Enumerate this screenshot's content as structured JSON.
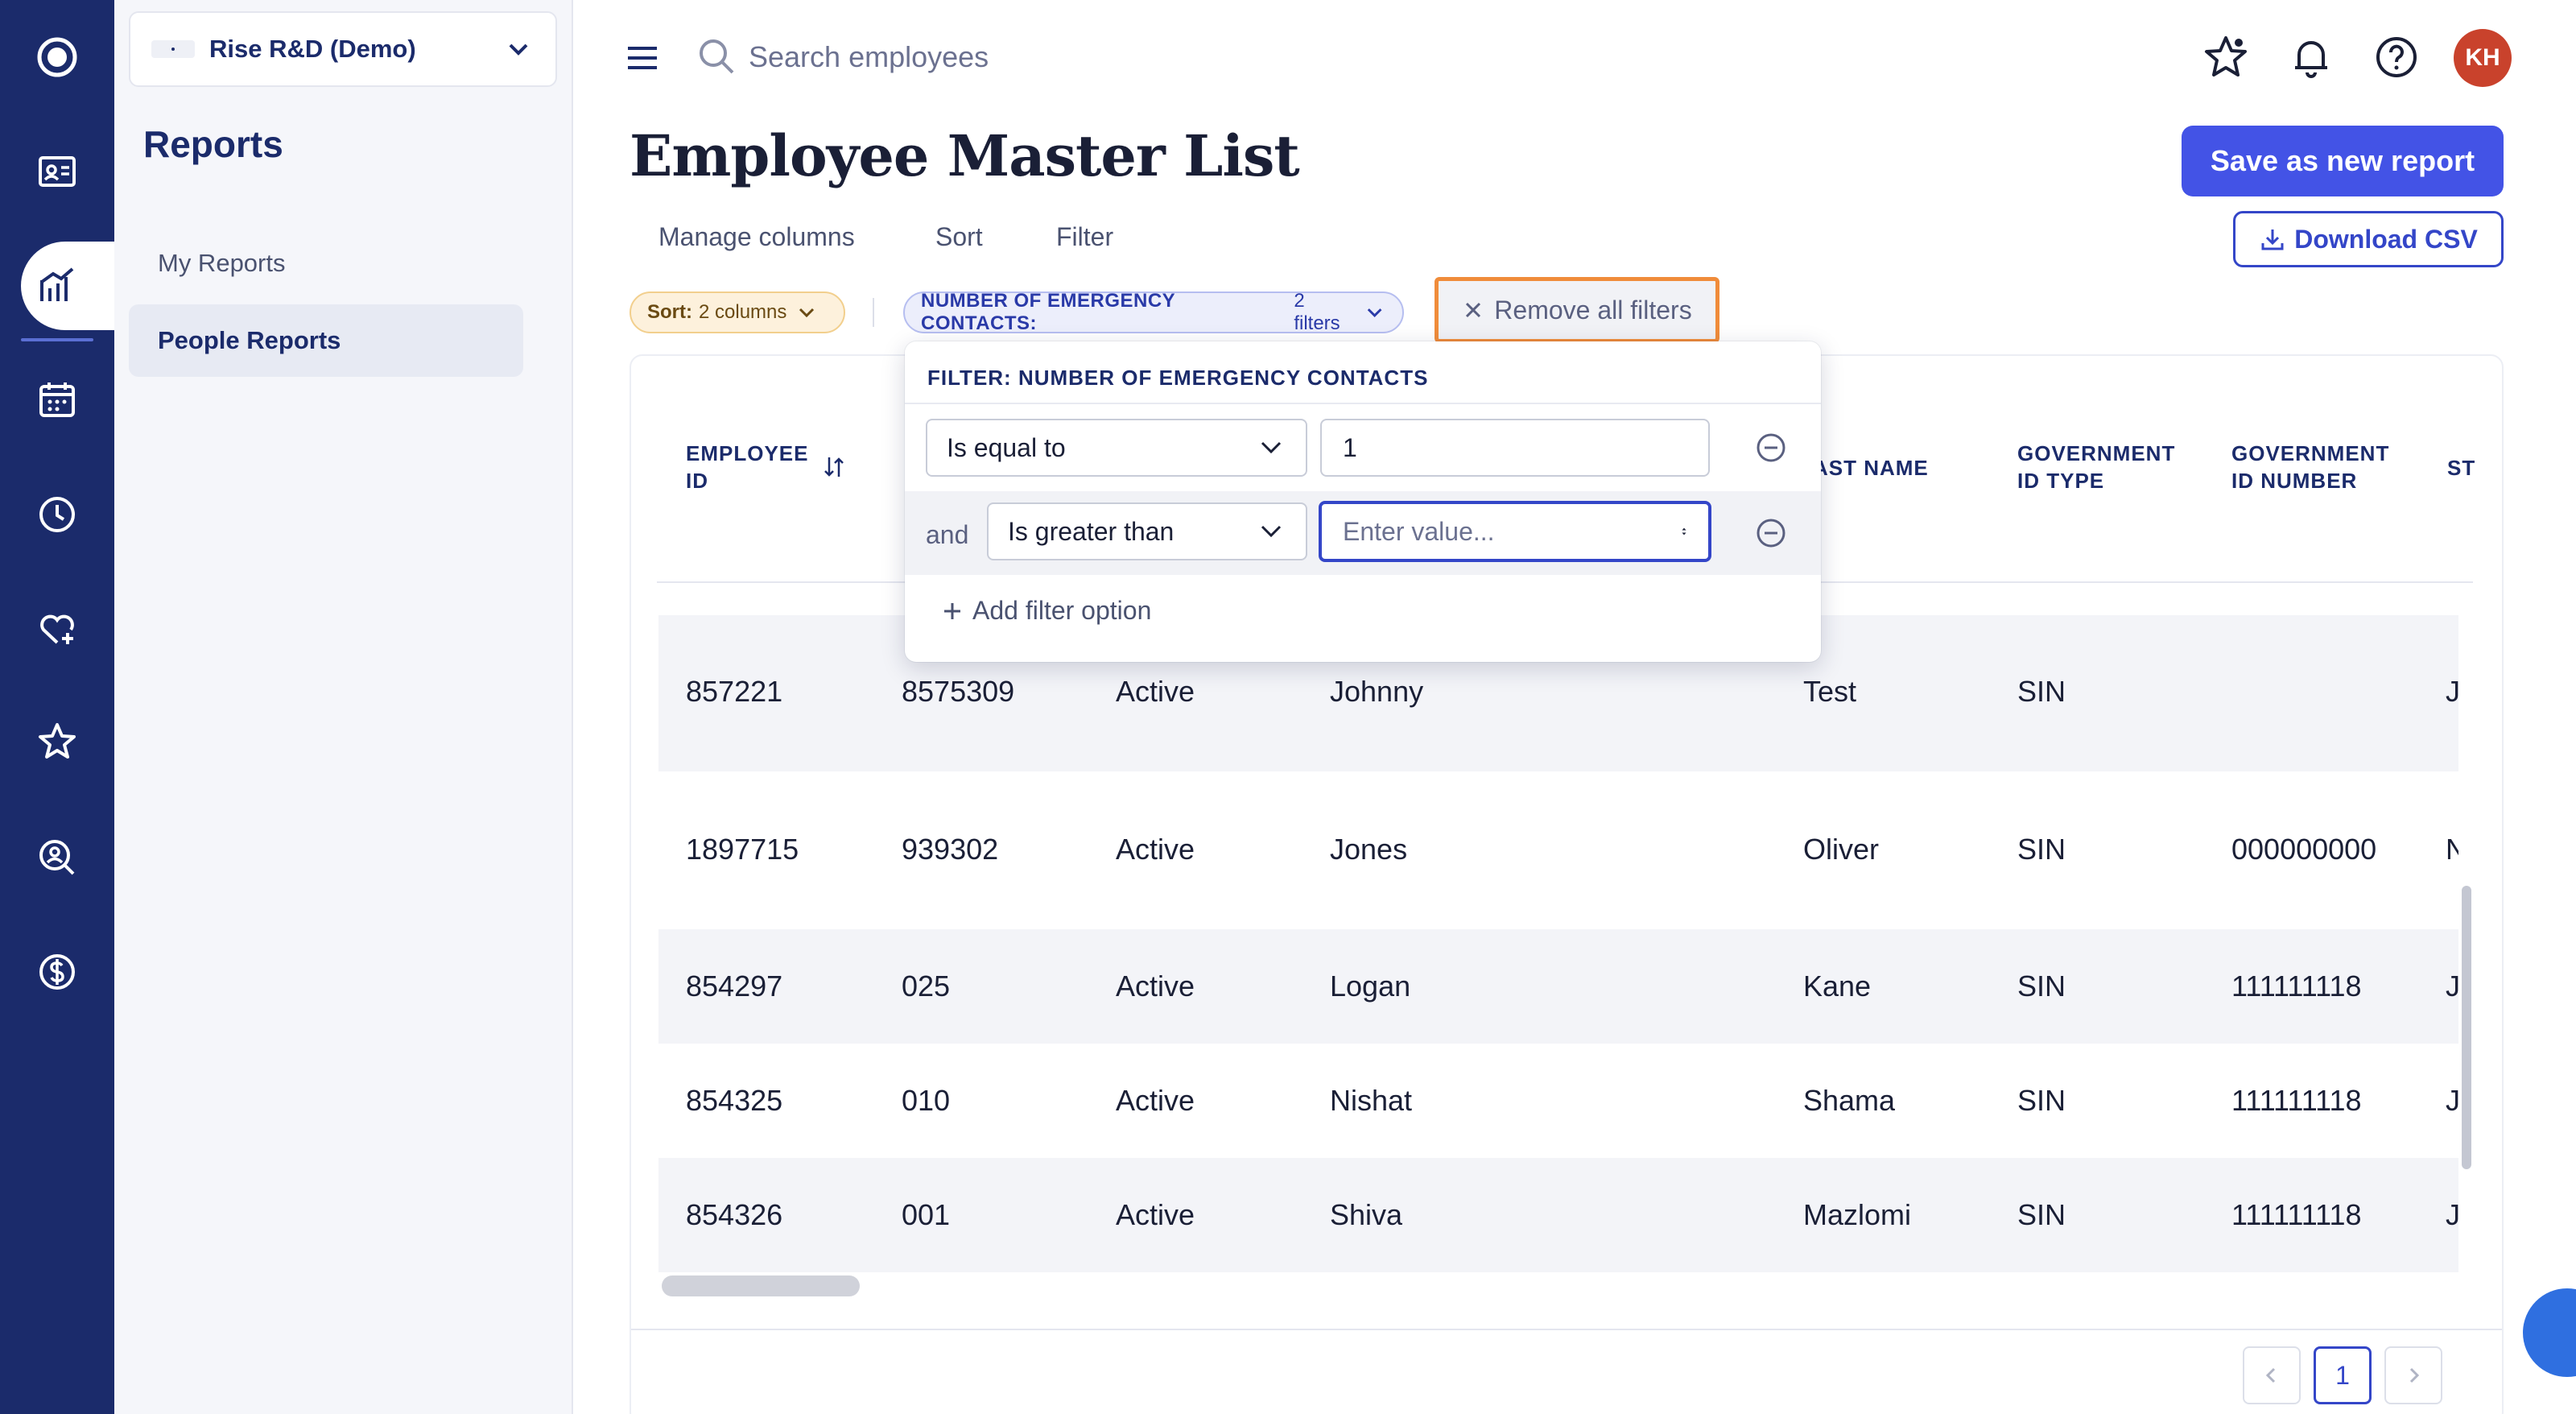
{
  "org": {
    "name": "Rise R&D (Demo)"
  },
  "sidebar": {
    "title": "Reports",
    "items": [
      {
        "label": "My Reports"
      },
      {
        "label": "People Reports"
      }
    ]
  },
  "search": {
    "placeholder": "Search employees"
  },
  "user": {
    "initials": "KH"
  },
  "page": {
    "title": "Employee Master List",
    "save_label": "Save as new report",
    "download_label": "Download CSV"
  },
  "toolbar": {
    "manage_columns": "Manage columns",
    "sort": "Sort",
    "filter": "Filter"
  },
  "chips": {
    "sort_label": "Sort:",
    "sort_value": "2 columns",
    "filter_label": "NUMBER OF EMERGENCY CONTACTS:",
    "filter_value": "2 filters",
    "remove_all": "Remove all filters"
  },
  "popover": {
    "title": "FILTER: NUMBER OF EMERGENCY CONTACTS",
    "row1": {
      "operator": "Is equal to",
      "value": "1"
    },
    "row2": {
      "joiner": "and",
      "operator": "Is greater than",
      "placeholder": "Enter value..."
    },
    "add_option": "Add filter option"
  },
  "table": {
    "headers": {
      "employee_id_1": "EMPLOYEE",
      "employee_id_2": "ID",
      "last_name": "AST NAME",
      "gov_type_1": "GOVERNMENT",
      "gov_type_2": "ID TYPE",
      "gov_num_1": "GOVERNMENT",
      "gov_num_2": "ID NUMBER",
      "st": "ST"
    },
    "rows": [
      {
        "id": "857221",
        "num": "8575309",
        "status": "Active",
        "first": "Johnny",
        "last": "Test",
        "gtype": "SIN",
        "gnum": "",
        "extra": "J"
      },
      {
        "id": "1897715",
        "num": "939302",
        "status": "Active",
        "first": "Jones",
        "last": "Oliver",
        "gtype": "SIN",
        "gnum": "000000000",
        "extra": "N"
      },
      {
        "id": "854297",
        "num": "025",
        "status": "Active",
        "first": "Logan",
        "last": "Kane",
        "gtype": "SIN",
        "gnum": "111111118",
        "extra": "J"
      },
      {
        "id": "854325",
        "num": "010",
        "status": "Active",
        "first": "Nishat",
        "last": "Shama",
        "gtype": "SIN",
        "gnum": "111111118",
        "extra": "J"
      },
      {
        "id": "854326",
        "num": "001",
        "status": "Active",
        "first": "Shiva",
        "last": "Mazlomi",
        "gtype": "SIN",
        "gnum": "111111118",
        "extra": "J"
      }
    ]
  },
  "pagination": {
    "current": "1"
  },
  "colors": {
    "rail": "#1b2b6b",
    "accent": "#4353e6",
    "highlight": "#f08c3a"
  }
}
